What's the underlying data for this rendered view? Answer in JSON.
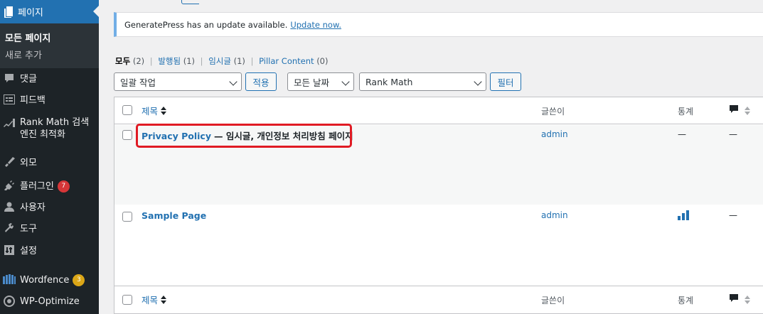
{
  "sidebar": {
    "pages": "페이지",
    "submenu": [
      "모든 페이지",
      "새로 추가"
    ],
    "comments": "댓글",
    "feedback": "피드백",
    "rankmath": "Rank Math 검색엔진 최적화",
    "appearance": "외모",
    "plugins": "플러그인",
    "plugins_badge": "7",
    "users": "사용자",
    "tools": "도구",
    "settings": "설정",
    "wordfence": "Wordfence",
    "wordfence_badge": "3",
    "wpoptimize": "WP-Optimize"
  },
  "notice": {
    "text": "GeneratePress has an update available.",
    "link": "Update now."
  },
  "filters": {
    "all": "모두",
    "all_count": "(2)",
    "published": "발행됨",
    "published_count": "(1)",
    "draft": "임시글",
    "draft_count": "(1)",
    "pillar": "Pillar Content",
    "pillar_count": "(0)",
    "separator": "|"
  },
  "controls": {
    "bulk_action": "일괄 작업",
    "apply": "적용",
    "dates": "모든 날짜",
    "rankmath": "Rank Math",
    "filter": "필터"
  },
  "table": {
    "col_title": "제목",
    "col_author": "글쓴이",
    "col_stats": "통계",
    "rows": [
      {
        "title": "Privacy Policy",
        "state": "— 임시글, 개인정보 처리방침 페이지",
        "author": "admin",
        "stats": "—",
        "comments": "—"
      },
      {
        "title": "Sample Page",
        "state": "",
        "author": "admin",
        "stats": "",
        "comments": "—"
      }
    ]
  },
  "colors": {
    "sidebar_bg": "#1d2327",
    "accent": "#2271b1",
    "highlight": "#e01b24"
  }
}
